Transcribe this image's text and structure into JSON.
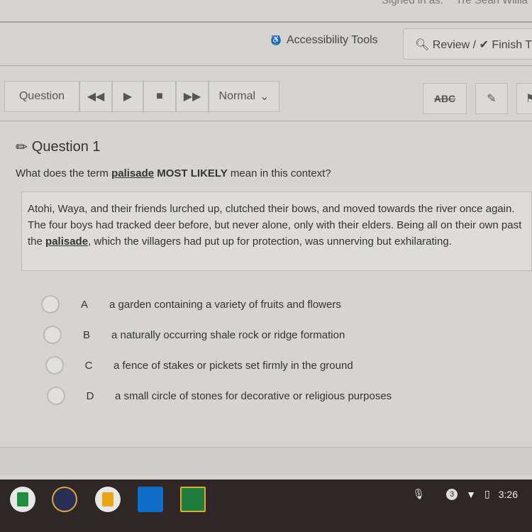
{
  "header": {
    "signed_in_label": "Signed in as:",
    "user_name": "Tre Sean Willia"
  },
  "top": {
    "accessibility_tools": "Accessibility Tools",
    "review_finish": "Review / ✔ Finish T"
  },
  "toolbar": {
    "question_label": "Question",
    "rewind": "◀◀",
    "play": "▶",
    "stop": "■",
    "forward": "▶▶",
    "speed": "Normal",
    "abc": "ABC",
    "edit": "✎"
  },
  "question": {
    "title": "Question 1",
    "prompt_pre": "What does the term ",
    "prompt_term": "palisade",
    "prompt_emph": " MOST LIKELY",
    "prompt_post": " mean in this context?",
    "passage_pre": "Atohi, Waya, and their friends lurched up, clutched their bows, and moved towards the river once again. The four boys had tracked deer before, but never alone, only with their elders. Being all on their own past the ",
    "passage_term": "palisade",
    "passage_post": ", which the villagers had put up for protection, was unnerving but exhilarating.",
    "options": [
      {
        "letter": "A",
        "text": "a garden containing a variety of fruits and flowers"
      },
      {
        "letter": "B",
        "text": "a naturally occurring shale rock or ridge formation"
      },
      {
        "letter": "C",
        "text": "a fence of stakes or pickets set firmly in the ground"
      },
      {
        "letter": "D",
        "text": "a small circle of stones for decorative or religious purposes"
      }
    ],
    "selected": null
  },
  "taskbar": {
    "apps": [
      "sheets-icon",
      "power-icon",
      "slides-icon",
      "outlook-icon",
      "classroom-icon"
    ],
    "notification_count": "3",
    "time": "3:26"
  }
}
